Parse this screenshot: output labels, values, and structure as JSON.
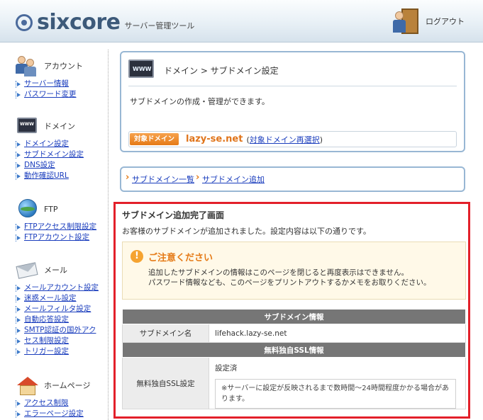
{
  "header": {
    "logo_text": "sixcore",
    "logo_subtitle": "サーバー管理ツール",
    "logout_label": "ログアウト"
  },
  "sidebar": {
    "sections": [
      {
        "title": "アカウント",
        "icon": "account-icon",
        "links": [
          "サーバー情報",
          "パスワード変更"
        ]
      },
      {
        "title": "ドメイン",
        "icon": "domain-icon",
        "links": [
          "ドメイン設定",
          "サブドメイン設定",
          "DNS設定",
          "動作確認URL"
        ]
      },
      {
        "title": "FTP",
        "icon": "ftp-globe-icon",
        "links": [
          "FTPアクセス制限設定",
          "FTPアカウント設定"
        ]
      },
      {
        "title": "メール",
        "icon": "mail-icon",
        "links": [
          "メールアカウント設定",
          "迷惑メール設定",
          "メールフィルタ設定",
          "自動応答設定",
          "SMTP認証の国外アク",
          "セス制限設定",
          "トリガー設定"
        ]
      },
      {
        "title": "ホームページ",
        "icon": "homepage-icon",
        "links": [
          "アクセス制限",
          "エラーページ設定"
        ]
      }
    ]
  },
  "main": {
    "panel_title": "ドメイン > サブドメイン設定",
    "panel_desc": "サブドメインの作成・管理ができます。",
    "domain_tag": "対象ドメイン",
    "domain_name": "lazy-se.net",
    "domain_open": "(",
    "domain_reselect": "対象ドメイン再選択",
    "domain_close": ")",
    "breadcrumbs": [
      "サブドメイン一覧",
      "サブドメイン追加"
    ]
  },
  "result": {
    "title": "サブドメイン追加完了画面",
    "message": "お客様のサブドメインが追加されました。設定内容は以下の通りです。",
    "notice": {
      "icon_text": "!",
      "heading": "ご注意ください",
      "line1": "追加したサブドメインの情報はこのページを閉じると再度表示はできません。",
      "line2": "パスワード情報なども、このページをプリントアウトするかメモをお取りください。"
    },
    "table": {
      "sub_header": "サブドメイン情報",
      "sub_label": "サブドメイン名",
      "sub_value": "lifehack.lazy-se.net",
      "ssl_header": "無料独自SSL情報",
      "ssl_label": "無料独自SSL設定",
      "ssl_status": "設定済",
      "ssl_note": "※サーバーに設定が反映されるまで数時間〜24時間程度かかる場合があります。"
    }
  },
  "colors": {
    "accent_orange": "#e57a16",
    "link_blue": "#1a3dbd",
    "highlight_red": "#e3202a"
  }
}
